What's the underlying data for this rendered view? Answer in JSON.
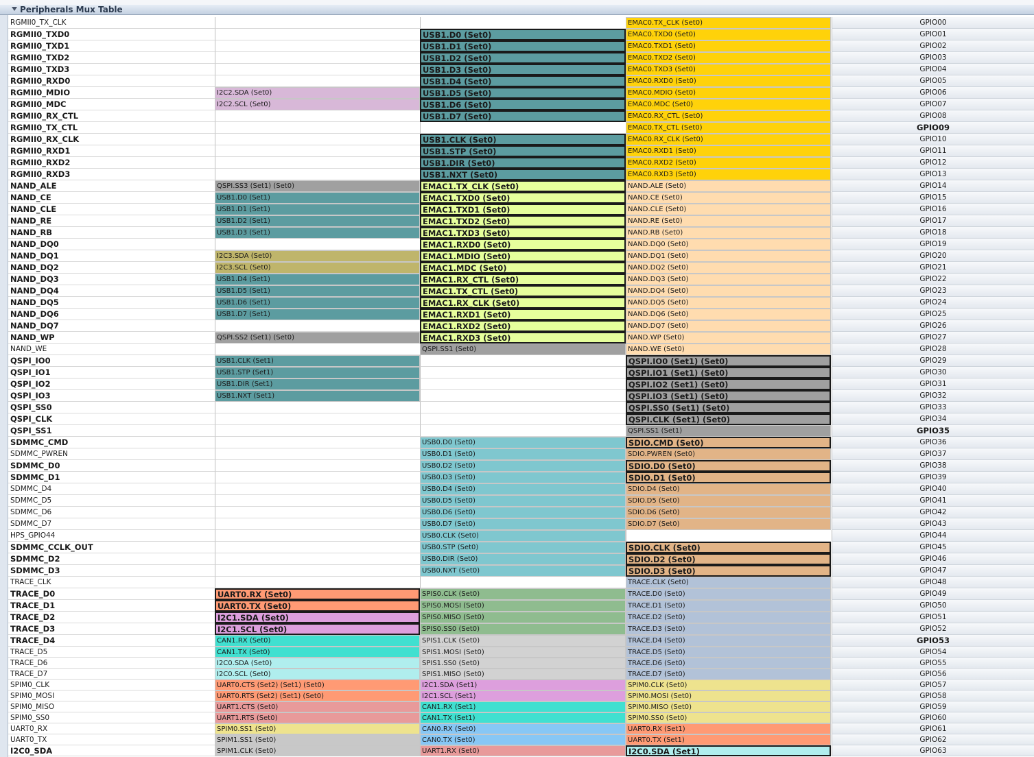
{
  "panel": {
    "title": "Peripherals Mux Table"
  },
  "colors": {
    "usb1_s0": "#5c9ca0",
    "usb1_s1": "#5c9ca0",
    "emac0": "#ffd20a",
    "emac1": "#e6ff9c",
    "nand": "#ffdcaf",
    "qspi": "#a0a0a0",
    "i2c2": "#d8b8d8",
    "i2c3": "#bfb56b",
    "usb0": "#7fc7cf",
    "sdio": "#e2b487",
    "trace": "#b2c2d8",
    "uart0": "#ff9a74",
    "i2c1": "#dd9fdd",
    "spis0": "#8fbc8f",
    "spis1": "#d2d2d2",
    "can1": "#40e0d0",
    "i2c0": "#b0eeee",
    "uart1": "#e89a9a",
    "spim0": "#eee38e",
    "spim1": "#c8c8c8",
    "can0": "#87c7f5"
  },
  "rows": [
    {
      "pin": "RGMII0_TX_CLK",
      "bold": false,
      "c1": null,
      "c2": null,
      "c3": {
        "t": "EMAC0.TX_CLK (Set0)",
        "c": "emac0"
      },
      "gpio": "GPIO00"
    },
    {
      "pin": "RGMII0_TXD0",
      "bold": true,
      "c1": null,
      "c2": {
        "t": "USB1.D0 (Set0)",
        "c": "usb1_s0",
        "b": true
      },
      "c3": {
        "t": "EMAC0.TXD0 (Set0)",
        "c": "emac0"
      },
      "gpio": "GPIO01"
    },
    {
      "pin": "RGMII0_TXD1",
      "bold": true,
      "c1": null,
      "c2": {
        "t": "USB1.D1 (Set0)",
        "c": "usb1_s0",
        "b": true
      },
      "c3": {
        "t": "EMAC0.TXD1 (Set0)",
        "c": "emac0"
      },
      "gpio": "GPIO02"
    },
    {
      "pin": "RGMII0_TXD2",
      "bold": true,
      "c1": null,
      "c2": {
        "t": "USB1.D2 (Set0)",
        "c": "usb1_s0",
        "b": true
      },
      "c3": {
        "t": "EMAC0.TXD2 (Set0)",
        "c": "emac0"
      },
      "gpio": "GPIO03"
    },
    {
      "pin": "RGMII0_TXD3",
      "bold": true,
      "c1": null,
      "c2": {
        "t": "USB1.D3 (Set0)",
        "c": "usb1_s0",
        "b": true
      },
      "c3": {
        "t": "EMAC0.TXD3 (Set0)",
        "c": "emac0"
      },
      "gpio": "GPIO04"
    },
    {
      "pin": "RGMII0_RXD0",
      "bold": true,
      "c1": null,
      "c2": {
        "t": "USB1.D4 (Set0)",
        "c": "usb1_s0",
        "b": true
      },
      "c3": {
        "t": "EMAC0.RXD0 (Set0)",
        "c": "emac0"
      },
      "gpio": "GPIO05"
    },
    {
      "pin": "RGMII0_MDIO",
      "bold": true,
      "c1": {
        "t": "I2C2.SDA (Set0)",
        "c": "i2c2"
      },
      "c2": {
        "t": "USB1.D5 (Set0)",
        "c": "usb1_s0",
        "b": true
      },
      "c3": {
        "t": "EMAC0.MDIO (Set0)",
        "c": "emac0"
      },
      "gpio": "GPIO06"
    },
    {
      "pin": "RGMII0_MDC",
      "bold": true,
      "c1": {
        "t": "I2C2.SCL (Set0)",
        "c": "i2c2"
      },
      "c2": {
        "t": "USB1.D6 (Set0)",
        "c": "usb1_s0",
        "b": true
      },
      "c3": {
        "t": "EMAC0.MDC (Set0)",
        "c": "emac0"
      },
      "gpio": "GPIO07"
    },
    {
      "pin": "RGMII0_RX_CTL",
      "bold": true,
      "c1": null,
      "c2": {
        "t": "USB1.D7 (Set0)",
        "c": "usb1_s0",
        "b": true
      },
      "c3": {
        "t": "EMAC0.RX_CTL (Set0)",
        "c": "emac0"
      },
      "gpio": "GPIO08"
    },
    {
      "pin": "RGMII0_TX_CTL",
      "bold": true,
      "c1": null,
      "c2": null,
      "c3": {
        "t": "EMAC0.TX_CTL (Set0)",
        "c": "emac0"
      },
      "gpio": "GPIO09",
      "gbold": true
    },
    {
      "pin": "RGMII0_RX_CLK",
      "bold": true,
      "c1": null,
      "c2": {
        "t": "USB1.CLK (Set0)",
        "c": "usb1_s0",
        "b": true
      },
      "c3": {
        "t": "EMAC0.RX_CLK (Set0)",
        "c": "emac0"
      },
      "gpio": "GPIO10"
    },
    {
      "pin": "RGMII0_RXD1",
      "bold": true,
      "c1": null,
      "c2": {
        "t": "USB1.STP (Set0)",
        "c": "usb1_s0",
        "b": true
      },
      "c3": {
        "t": "EMAC0.RXD1 (Set0)",
        "c": "emac0"
      },
      "gpio": "GPIO11"
    },
    {
      "pin": "RGMII0_RXD2",
      "bold": true,
      "c1": null,
      "c2": {
        "t": "USB1.DIR (Set0)",
        "c": "usb1_s0",
        "b": true
      },
      "c3": {
        "t": "EMAC0.RXD2 (Set0)",
        "c": "emac0"
      },
      "gpio": "GPIO12"
    },
    {
      "pin": "RGMII0_RXD3",
      "bold": true,
      "c1": null,
      "c2": {
        "t": "USB1.NXT (Set0)",
        "c": "usb1_s0",
        "b": true
      },
      "c3": {
        "t": "EMAC0.RXD3 (Set0)",
        "c": "emac0"
      },
      "gpio": "GPIO13"
    },
    {
      "pin": "NAND_ALE",
      "bold": true,
      "c1": {
        "t": "QSPI.SS3 (Set1) (Set0)",
        "c": "qspi"
      },
      "c2": {
        "t": "EMAC1.TX_CLK (Set0)",
        "c": "emac1",
        "b": true
      },
      "c3": {
        "t": "NAND.ALE (Set0)",
        "c": "nand"
      },
      "gpio": "GPIO14"
    },
    {
      "pin": "NAND_CE",
      "bold": true,
      "c1": {
        "t": "USB1.D0 (Set1)",
        "c": "usb1_s1"
      },
      "c2": {
        "t": "EMAC1.TXD0 (Set0)",
        "c": "emac1",
        "b": true
      },
      "c3": {
        "t": "NAND.CE (Set0)",
        "c": "nand"
      },
      "gpio": "GPIO15"
    },
    {
      "pin": "NAND_CLE",
      "bold": true,
      "c1": {
        "t": "USB1.D1 (Set1)",
        "c": "usb1_s1"
      },
      "c2": {
        "t": "EMAC1.TXD1 (Set0)",
        "c": "emac1",
        "b": true
      },
      "c3": {
        "t": "NAND.CLE (Set0)",
        "c": "nand"
      },
      "gpio": "GPIO16"
    },
    {
      "pin": "NAND_RE",
      "bold": true,
      "c1": {
        "t": "USB1.D2 (Set1)",
        "c": "usb1_s1"
      },
      "c2": {
        "t": "EMAC1.TXD2 (Set0)",
        "c": "emac1",
        "b": true
      },
      "c3": {
        "t": "NAND.RE (Set0)",
        "c": "nand"
      },
      "gpio": "GPIO17"
    },
    {
      "pin": "NAND_RB",
      "bold": true,
      "c1": {
        "t": "USB1.D3 (Set1)",
        "c": "usb1_s1"
      },
      "c2": {
        "t": "EMAC1.TXD3 (Set0)",
        "c": "emac1",
        "b": true
      },
      "c3": {
        "t": "NAND.RB (Set0)",
        "c": "nand"
      },
      "gpio": "GPIO18"
    },
    {
      "pin": "NAND_DQ0",
      "bold": true,
      "c1": null,
      "c2": {
        "t": "EMAC1.RXD0 (Set0)",
        "c": "emac1",
        "b": true
      },
      "c3": {
        "t": "NAND.DQ0 (Set0)",
        "c": "nand"
      },
      "gpio": "GPIO19"
    },
    {
      "pin": "NAND_DQ1",
      "bold": true,
      "c1": {
        "t": "I2C3.SDA (Set0)",
        "c": "i2c3"
      },
      "c2": {
        "t": "EMAC1.MDIO (Set0)",
        "c": "emac1",
        "b": true
      },
      "c3": {
        "t": "NAND.DQ1 (Set0)",
        "c": "nand"
      },
      "gpio": "GPIO20"
    },
    {
      "pin": "NAND_DQ2",
      "bold": true,
      "c1": {
        "t": "I2C3.SCL (Set0)",
        "c": "i2c3"
      },
      "c2": {
        "t": "EMAC1.MDC (Set0)",
        "c": "emac1",
        "b": true
      },
      "c3": {
        "t": "NAND.DQ2 (Set0)",
        "c": "nand"
      },
      "gpio": "GPIO21"
    },
    {
      "pin": "NAND_DQ3",
      "bold": true,
      "c1": {
        "t": "USB1.D4 (Set1)",
        "c": "usb1_s1"
      },
      "c2": {
        "t": "EMAC1.RX_CTL (Set0)",
        "c": "emac1",
        "b": true
      },
      "c3": {
        "t": "NAND.DQ3 (Set0)",
        "c": "nand"
      },
      "gpio": "GPIO22"
    },
    {
      "pin": "NAND_DQ4",
      "bold": true,
      "c1": {
        "t": "USB1.D5 (Set1)",
        "c": "usb1_s1"
      },
      "c2": {
        "t": "EMAC1.TX_CTL (Set0)",
        "c": "emac1",
        "b": true
      },
      "c3": {
        "t": "NAND.DQ4 (Set0)",
        "c": "nand"
      },
      "gpio": "GPIO23"
    },
    {
      "pin": "NAND_DQ5",
      "bold": true,
      "c1": {
        "t": "USB1.D6 (Set1)",
        "c": "usb1_s1"
      },
      "c2": {
        "t": "EMAC1.RX_CLK (Set0)",
        "c": "emac1",
        "b": true
      },
      "c3": {
        "t": "NAND.DQ5 (Set0)",
        "c": "nand"
      },
      "gpio": "GPIO24"
    },
    {
      "pin": "NAND_DQ6",
      "bold": true,
      "c1": {
        "t": "USB1.D7 (Set1)",
        "c": "usb1_s1"
      },
      "c2": {
        "t": "EMAC1.RXD1 (Set0)",
        "c": "emac1",
        "b": true
      },
      "c3": {
        "t": "NAND.DQ6 (Set0)",
        "c": "nand"
      },
      "gpio": "GPIO25"
    },
    {
      "pin": "NAND_DQ7",
      "bold": true,
      "c1": null,
      "c2": {
        "t": "EMAC1.RXD2 (Set0)",
        "c": "emac1",
        "b": true
      },
      "c3": {
        "t": "NAND.DQ7 (Set0)",
        "c": "nand"
      },
      "gpio": "GPIO26"
    },
    {
      "pin": "NAND_WP",
      "bold": true,
      "c1": {
        "t": "QSPI.SS2 (Set1) (Set0)",
        "c": "qspi"
      },
      "c2": {
        "t": "EMAC1.RXD3 (Set0)",
        "c": "emac1",
        "b": true
      },
      "c3": {
        "t": "NAND.WP (Set0)",
        "c": "nand"
      },
      "gpio": "GPIO27"
    },
    {
      "pin": "NAND_WE",
      "bold": false,
      "c1": null,
      "c2": {
        "t": "QSPI.SS1 (Set0)",
        "c": "qspi"
      },
      "c3": {
        "t": "NAND.WE (Set0)",
        "c": "nand"
      },
      "gpio": "GPIO28"
    },
    {
      "pin": "QSPI_IO0",
      "bold": true,
      "c1": {
        "t": "USB1.CLK (Set1)",
        "c": "usb1_s1"
      },
      "c2": null,
      "c3": {
        "t": "QSPI.IO0 (Set1) (Set0)",
        "c": "qspi",
        "b": true
      },
      "gpio": "GPIO29"
    },
    {
      "pin": "QSPI_IO1",
      "bold": true,
      "c1": {
        "t": "USB1.STP (Set1)",
        "c": "usb1_s1"
      },
      "c2": null,
      "c3": {
        "t": "QSPI.IO1 (Set1) (Set0)",
        "c": "qspi",
        "b": true
      },
      "gpio": "GPIO30"
    },
    {
      "pin": "QSPI_IO2",
      "bold": true,
      "c1": {
        "t": "USB1.DIR (Set1)",
        "c": "usb1_s1"
      },
      "c2": null,
      "c3": {
        "t": "QSPI.IO2 (Set1) (Set0)",
        "c": "qspi",
        "b": true
      },
      "gpio": "GPIO31"
    },
    {
      "pin": "QSPI_IO3",
      "bold": true,
      "c1": {
        "t": "USB1.NXT (Set1)",
        "c": "usb1_s1"
      },
      "c2": null,
      "c3": {
        "t": "QSPI.IO3 (Set1) (Set0)",
        "c": "qspi",
        "b": true
      },
      "gpio": "GPIO32"
    },
    {
      "pin": "QSPI_SS0",
      "bold": true,
      "c1": null,
      "c2": null,
      "c3": {
        "t": "QSPI.SS0 (Set1) (Set0)",
        "c": "qspi",
        "b": true
      },
      "gpio": "GPIO33"
    },
    {
      "pin": "QSPI_CLK",
      "bold": true,
      "c1": null,
      "c2": null,
      "c3": {
        "t": "QSPI.CLK (Set1) (Set0)",
        "c": "qspi",
        "b": true
      },
      "gpio": "GPIO34"
    },
    {
      "pin": "QSPI_SS1",
      "bold": true,
      "c1": null,
      "c2": null,
      "c3": {
        "t": "QSPI.SS1 (Set1)",
        "c": "qspi"
      },
      "gpio": "GPIO35",
      "gbold": true
    },
    {
      "pin": "SDMMC_CMD",
      "bold": true,
      "c1": null,
      "c2": {
        "t": "USB0.D0 (Set0)",
        "c": "usb0"
      },
      "c3": {
        "t": "SDIO.CMD (Set0)",
        "c": "sdio",
        "b": true
      },
      "gpio": "GPIO36"
    },
    {
      "pin": "SDMMC_PWREN",
      "bold": false,
      "c1": null,
      "c2": {
        "t": "USB0.D1 (Set0)",
        "c": "usb0"
      },
      "c3": {
        "t": "SDIO.PWREN (Set0)",
        "c": "sdio"
      },
      "gpio": "GPIO37"
    },
    {
      "pin": "SDMMC_D0",
      "bold": true,
      "c1": null,
      "c2": {
        "t": "USB0.D2 (Set0)",
        "c": "usb0"
      },
      "c3": {
        "t": "SDIO.D0 (Set0)",
        "c": "sdio",
        "b": true
      },
      "gpio": "GPIO38"
    },
    {
      "pin": "SDMMC_D1",
      "bold": true,
      "c1": null,
      "c2": {
        "t": "USB0.D3 (Set0)",
        "c": "usb0"
      },
      "c3": {
        "t": "SDIO.D1 (Set0)",
        "c": "sdio",
        "b": true
      },
      "gpio": "GPIO39"
    },
    {
      "pin": "SDMMC_D4",
      "bold": false,
      "c1": null,
      "c2": {
        "t": "USB0.D4 (Set0)",
        "c": "usb0"
      },
      "c3": {
        "t": "SDIO.D4 (Set0)",
        "c": "sdio"
      },
      "gpio": "GPIO40"
    },
    {
      "pin": "SDMMC_D5",
      "bold": false,
      "c1": null,
      "c2": {
        "t": "USB0.D5 (Set0)",
        "c": "usb0"
      },
      "c3": {
        "t": "SDIO.D5 (Set0)",
        "c": "sdio"
      },
      "gpio": "GPIO41"
    },
    {
      "pin": "SDMMC_D6",
      "bold": false,
      "c1": null,
      "c2": {
        "t": "USB0.D6 (Set0)",
        "c": "usb0"
      },
      "c3": {
        "t": "SDIO.D6 (Set0)",
        "c": "sdio"
      },
      "gpio": "GPIO42"
    },
    {
      "pin": "SDMMC_D7",
      "bold": false,
      "c1": null,
      "c2": {
        "t": "USB0.D7 (Set0)",
        "c": "usb0"
      },
      "c3": {
        "t": "SDIO.D7 (Set0)",
        "c": "sdio"
      },
      "gpio": "GPIO43"
    },
    {
      "pin": "HPS_GPIO44",
      "bold": false,
      "c1": null,
      "c2": {
        "t": "USB0.CLK (Set0)",
        "c": "usb0"
      },
      "c3": null,
      "gpio": "GPIO44"
    },
    {
      "pin": "SDMMC_CCLK_OUT",
      "bold": true,
      "c1": null,
      "c2": {
        "t": "USB0.STP (Set0)",
        "c": "usb0"
      },
      "c3": {
        "t": "SDIO.CLK (Set0)",
        "c": "sdio",
        "b": true
      },
      "gpio": "GPIO45"
    },
    {
      "pin": "SDMMC_D2",
      "bold": true,
      "c1": null,
      "c2": {
        "t": "USB0.DIR (Set0)",
        "c": "usb0"
      },
      "c3": {
        "t": "SDIO.D2 (Set0)",
        "c": "sdio",
        "b": true
      },
      "gpio": "GPIO46"
    },
    {
      "pin": "SDMMC_D3",
      "bold": true,
      "c1": null,
      "c2": {
        "t": "USB0.NXT (Set0)",
        "c": "usb0"
      },
      "c3": {
        "t": "SDIO.D3 (Set0)",
        "c": "sdio",
        "b": true
      },
      "gpio": "GPIO47"
    },
    {
      "pin": "TRACE_CLK",
      "bold": false,
      "c1": null,
      "c2": null,
      "c3": {
        "t": "TRACE.CLK (Set0)",
        "c": "trace"
      },
      "gpio": "GPIO48"
    },
    {
      "pin": "TRACE_D0",
      "bold": true,
      "c1": {
        "t": "UART0.RX (Set0)",
        "c": "uart0",
        "b": true
      },
      "c2": {
        "t": "SPIS0.CLK (Set0)",
        "c": "spis0"
      },
      "c3": {
        "t": "TRACE.D0 (Set0)",
        "c": "trace"
      },
      "gpio": "GPIO49"
    },
    {
      "pin": "TRACE_D1",
      "bold": true,
      "c1": {
        "t": "UART0.TX (Set0)",
        "c": "uart0",
        "b": true
      },
      "c2": {
        "t": "SPIS0.MOSI (Set0)",
        "c": "spis0"
      },
      "c3": {
        "t": "TRACE.D1 (Set0)",
        "c": "trace"
      },
      "gpio": "GPIO50"
    },
    {
      "pin": "TRACE_D2",
      "bold": true,
      "c1": {
        "t": "I2C1.SDA (Set0)",
        "c": "i2c1",
        "b": true
      },
      "c2": {
        "t": "SPIS0.MISO (Set0)",
        "c": "spis0"
      },
      "c3": {
        "t": "TRACE.D2 (Set0)",
        "c": "trace"
      },
      "gpio": "GPIO51"
    },
    {
      "pin": "TRACE_D3",
      "bold": true,
      "c1": {
        "t": "I2C1.SCL (Set0)",
        "c": "i2c1",
        "b": true
      },
      "c2": {
        "t": "SPIS0.SS0 (Set0)",
        "c": "spis0"
      },
      "c3": {
        "t": "TRACE.D3 (Set0)",
        "c": "trace"
      },
      "gpio": "GPIO52"
    },
    {
      "pin": "TRACE_D4",
      "bold": true,
      "c1": {
        "t": "CAN1.RX (Set0)",
        "c": "can1"
      },
      "c2": {
        "t": "SPIS1.CLK (Set0)",
        "c": "spis1"
      },
      "c3": {
        "t": "TRACE.D4 (Set0)",
        "c": "trace"
      },
      "gpio": "GPIO53",
      "gbold": true
    },
    {
      "pin": "TRACE_D5",
      "bold": false,
      "c1": {
        "t": "CAN1.TX (Set0)",
        "c": "can1"
      },
      "c2": {
        "t": "SPIS1.MOSI (Set0)",
        "c": "spis1"
      },
      "c3": {
        "t": "TRACE.D5 (Set0)",
        "c": "trace"
      },
      "gpio": "GPIO54"
    },
    {
      "pin": "TRACE_D6",
      "bold": false,
      "c1": {
        "t": "I2C0.SDA (Set0)",
        "c": "i2c0"
      },
      "c2": {
        "t": "SPIS1.SS0 (Set0)",
        "c": "spis1"
      },
      "c3": {
        "t": "TRACE.D6 (Set0)",
        "c": "trace"
      },
      "gpio": "GPIO55"
    },
    {
      "pin": "TRACE_D7",
      "bold": false,
      "c1": {
        "t": "I2C0.SCL (Set0)",
        "c": "i2c0"
      },
      "c2": {
        "t": "SPIS1.MISO (Set0)",
        "c": "spis1"
      },
      "c3": {
        "t": "TRACE.D7 (Set0)",
        "c": "trace"
      },
      "gpio": "GPIO56"
    },
    {
      "pin": "SPIM0_CLK",
      "bold": false,
      "c1": {
        "t": "UART0.CTS (Set2) (Set1) (Set0)",
        "c": "uart0"
      },
      "c2": {
        "t": "I2C1.SDA (Set1)",
        "c": "i2c1"
      },
      "c3": {
        "t": "SPIM0.CLK (Set0)",
        "c": "spim0"
      },
      "gpio": "GPIO57"
    },
    {
      "pin": "SPIM0_MOSI",
      "bold": false,
      "c1": {
        "t": "UART0.RTS (Set2) (Set1) (Set0)",
        "c": "uart0"
      },
      "c2": {
        "t": "I2C1.SCL (Set1)",
        "c": "i2c1"
      },
      "c3": {
        "t": "SPIM0.MOSI (Set0)",
        "c": "spim0"
      },
      "gpio": "GPIO58"
    },
    {
      "pin": "SPIM0_MISO",
      "bold": false,
      "c1": {
        "t": "UART1.CTS (Set0)",
        "c": "uart1"
      },
      "c2": {
        "t": "CAN1.RX (Set1)",
        "c": "can1"
      },
      "c3": {
        "t": "SPIM0.MISO (Set0)",
        "c": "spim0"
      },
      "gpio": "GPIO59"
    },
    {
      "pin": "SPIM0_SS0",
      "bold": false,
      "c1": {
        "t": "UART1.RTS (Set0)",
        "c": "uart1"
      },
      "c2": {
        "t": "CAN1.TX (Set1)",
        "c": "can1"
      },
      "c3": {
        "t": "SPIM0.SS0 (Set0)",
        "c": "spim0"
      },
      "gpio": "GPIO60"
    },
    {
      "pin": "UART0_RX",
      "bold": false,
      "c1": {
        "t": "SPIM0.SS1 (Set0)",
        "c": "spim0"
      },
      "c2": {
        "t": "CAN0.RX (Set0)",
        "c": "can0"
      },
      "c3": {
        "t": "UART0.RX (Set1)",
        "c": "uart0"
      },
      "gpio": "GPIO61"
    },
    {
      "pin": "UART0_TX",
      "bold": false,
      "c1": {
        "t": "SPIM1.SS1 (Set0)",
        "c": "spim1"
      },
      "c2": {
        "t": "CAN0.TX (Set0)",
        "c": "can0"
      },
      "c3": {
        "t": "UART0.TX (Set1)",
        "c": "uart0"
      },
      "gpio": "GPIO62"
    },
    {
      "pin": "I2C0_SDA",
      "bold": true,
      "c1": {
        "t": "SPIM1.CLK (Set0)",
        "c": "spim1"
      },
      "c2": {
        "t": "UART1.RX (Set0)",
        "c": "uart1"
      },
      "c3": {
        "t": "I2C0.SDA (Set1)",
        "c": "i2c0",
        "b": true
      },
      "gpio": "GPIO63"
    }
  ]
}
